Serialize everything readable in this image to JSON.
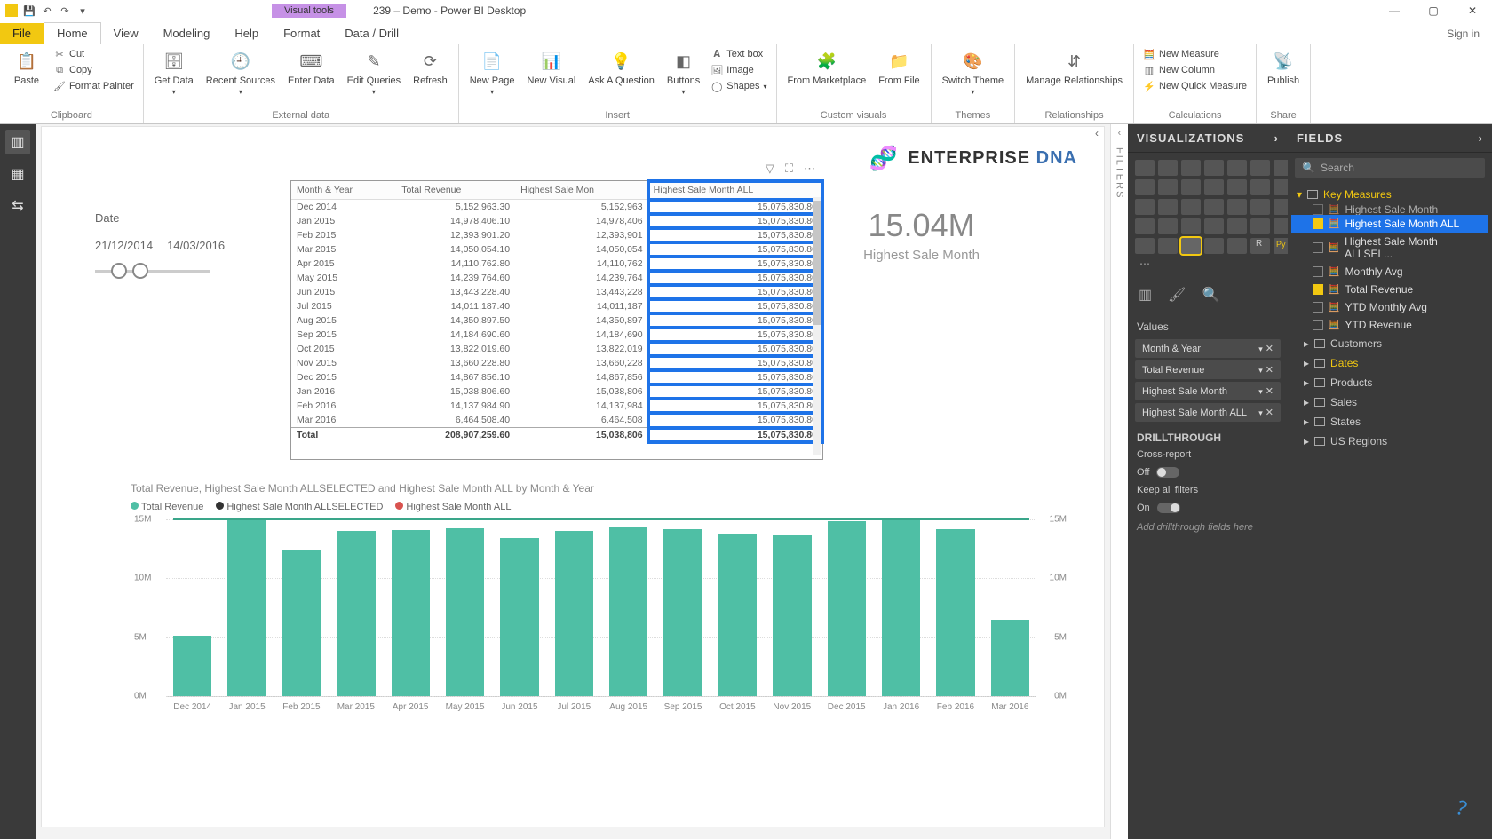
{
  "window": {
    "title": "239 – Demo - Power BI Desktop",
    "visual_tools": "Visual tools",
    "signin": "Sign in"
  },
  "tabs": {
    "file": "File",
    "home": "Home",
    "view": "View",
    "modeling": "Modeling",
    "help": "Help",
    "format": "Format",
    "datadrill": "Data / Drill"
  },
  "ribbon": {
    "clipboard": {
      "paste": "Paste",
      "cut": "Cut",
      "copy": "Copy",
      "fp": "Format Painter",
      "label": "Clipboard"
    },
    "external": {
      "get": "Get Data",
      "recent": "Recent Sources",
      "enter": "Enter Data",
      "edit": "Edit Queries",
      "refresh": "Refresh",
      "label": "External data"
    },
    "insert": {
      "newpage": "New Page",
      "newvis": "New Visual",
      "ask": "Ask A Question",
      "buttons": "Buttons",
      "textbox": "Text box",
      "image": "Image",
      "shapes": "Shapes",
      "label": "Insert"
    },
    "custom": {
      "market": "From Marketplace",
      "file": "From File",
      "label": "Custom visuals"
    },
    "themes": {
      "switch": "Switch Theme",
      "label": "Themes"
    },
    "rel": {
      "manage": "Manage Relationships",
      "label": "Relationships"
    },
    "calc": {
      "measure": "New Measure",
      "column": "New Column",
      "quick": "New Quick Measure",
      "label": "Calculations"
    },
    "share": {
      "publish": "Publish",
      "label": "Share"
    }
  },
  "slicer": {
    "title": "Date",
    "from": "21/12/2014",
    "to": "14/03/2016"
  },
  "card": {
    "value": "15.04M",
    "caption": "Highest Sale Month"
  },
  "logo": {
    "brand": "ENTERPRISE",
    "accent": "DNA"
  },
  "table": {
    "headers": [
      "Month & Year",
      "Total Revenue",
      "Highest Sale Mon",
      "Highest Sale Month ALL"
    ],
    "rows": [
      [
        "Dec 2014",
        "5,152,963.30",
        "5,152,963",
        "15,075,830.80"
      ],
      [
        "Jan 2015",
        "14,978,406.10",
        "14,978,406",
        "15,075,830.80"
      ],
      [
        "Feb 2015",
        "12,393,901.20",
        "12,393,901",
        "15,075,830.80"
      ],
      [
        "Mar 2015",
        "14,050,054.10",
        "14,050,054",
        "15,075,830.80"
      ],
      [
        "Apr 2015",
        "14,110,762.80",
        "14,110,762",
        "15,075,830.80"
      ],
      [
        "May 2015",
        "14,239,764.60",
        "14,239,764",
        "15,075,830.80"
      ],
      [
        "Jun 2015",
        "13,443,228.40",
        "13,443,228",
        "15,075,830.80"
      ],
      [
        "Jul 2015",
        "14,011,187.40",
        "14,011,187",
        "15,075,830.80"
      ],
      [
        "Aug 2015",
        "14,350,897.50",
        "14,350,897",
        "15,075,830.80"
      ],
      [
        "Sep 2015",
        "14,184,690.60",
        "14,184,690",
        "15,075,830.80"
      ],
      [
        "Oct 2015",
        "13,822,019.60",
        "13,822,019",
        "15,075,830.80"
      ],
      [
        "Nov 2015",
        "13,660,228.80",
        "13,660,228",
        "15,075,830.80"
      ],
      [
        "Dec 2015",
        "14,867,856.10",
        "14,867,856",
        "15,075,830.80"
      ],
      [
        "Jan 2016",
        "15,038,806.60",
        "15,038,806",
        "15,075,830.80"
      ],
      [
        "Feb 2016",
        "14,137,984.90",
        "14,137,984",
        "15,075,830.80"
      ],
      [
        "Mar 2016",
        "6,464,508.40",
        "6,464,508",
        "15,075,830.80"
      ]
    ],
    "total": [
      "Total",
      "208,907,259.60",
      "15,038,806",
      "15,075,830.80"
    ]
  },
  "chart": {
    "title": "Total Revenue, Highest Sale Month ALLSELECTED and Highest Sale Month ALL by Month & Year",
    "legend": [
      "Total Revenue",
      "Highest Sale Month ALLSELECTED",
      "Highest Sale Month ALL"
    ]
  },
  "chart_data": {
    "type": "bar",
    "categories": [
      "Dec 2014",
      "Jan 2015",
      "Feb 2015",
      "Mar 2015",
      "Apr 2015",
      "May 2015",
      "Jun 2015",
      "Jul 2015",
      "Aug 2015",
      "Sep 2015",
      "Oct 2015",
      "Nov 2015",
      "Dec 2015",
      "Jan 2016",
      "Feb 2016",
      "Mar 2016"
    ],
    "series": [
      {
        "name": "Total Revenue",
        "values": [
          5.15,
          14.98,
          12.39,
          14.05,
          14.11,
          14.24,
          13.44,
          14.01,
          14.35,
          14.18,
          13.82,
          13.66,
          14.87,
          15.04,
          14.14,
          6.46
        ]
      },
      {
        "name": "Highest Sale Month ALLSELECTED",
        "values": [
          15.04,
          15.04,
          15.04,
          15.04,
          15.04,
          15.04,
          15.04,
          15.04,
          15.04,
          15.04,
          15.04,
          15.04,
          15.04,
          15.04,
          15.04,
          15.04
        ]
      },
      {
        "name": "Highest Sale Month ALL",
        "values": [
          15.08,
          15.08,
          15.08,
          15.08,
          15.08,
          15.08,
          15.08,
          15.08,
          15.08,
          15.08,
          15.08,
          15.08,
          15.08,
          15.08,
          15.08,
          15.08
        ]
      }
    ],
    "ylabel": "M",
    "ylim": [
      0,
      15
    ],
    "yticks": [
      0,
      5,
      10,
      15
    ],
    "ytick_labels_left": [
      "0M",
      "5M",
      "10M",
      "15M"
    ],
    "ytick_labels_right": [
      "0M",
      "5M",
      "10M",
      "15M"
    ]
  },
  "viz": {
    "header": "VISUALIZATIONS",
    "values_label": "Values",
    "wells": [
      "Month & Year",
      "Total Revenue",
      "Highest Sale Month",
      "Highest Sale Month ALL"
    ],
    "drill": "DRILLTHROUGH",
    "cross": "Cross-report",
    "cross_state": "Off",
    "keep": "Keep all filters",
    "keep_state": "On",
    "hint": "Add drillthrough fields here"
  },
  "fields": {
    "header": "FIELDS",
    "search": "Search",
    "key": "Key Measures",
    "measures": [
      {
        "name": "Highest Sale Month",
        "checked": false,
        "clipped": true
      },
      {
        "name": "Highest Sale Month ALL",
        "checked": true,
        "selected": true
      },
      {
        "name": "Highest Sale Month ALLSEL...",
        "checked": false
      },
      {
        "name": "Monthly Avg",
        "checked": false
      },
      {
        "name": "Total Revenue",
        "checked": true
      },
      {
        "name": "YTD Monthly Avg",
        "checked": false
      },
      {
        "name": "YTD Revenue",
        "checked": false
      }
    ],
    "tables": [
      "Customers",
      "Dates",
      "Products",
      "Sales",
      "States",
      "US Regions"
    ]
  },
  "filters_label": "FILTERS"
}
